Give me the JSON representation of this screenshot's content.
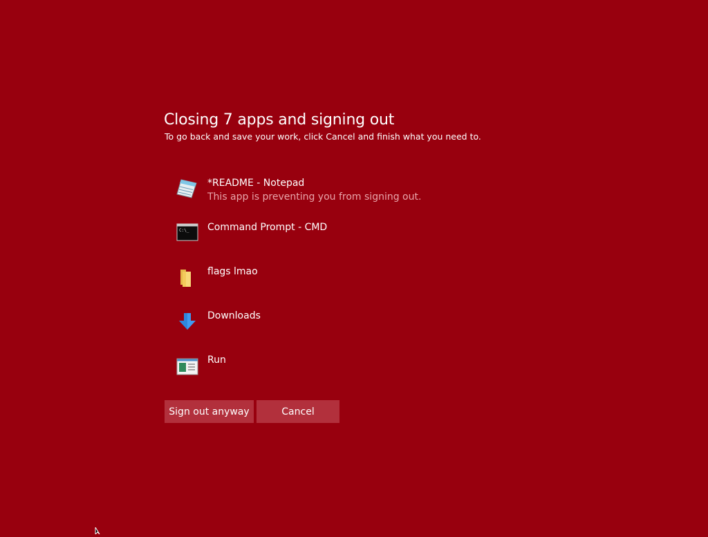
{
  "header": {
    "title": "Closing 7 apps and signing out",
    "subtitle": "To go back and save your work, click Cancel and finish what you need to."
  },
  "apps": [
    {
      "name": "*README - Notepad",
      "status": "This app is preventing you from signing out.",
      "icon": "notepad-icon"
    },
    {
      "name": "Command Prompt - CMD",
      "status": "",
      "icon": "command-prompt-icon"
    },
    {
      "name": "flags lmao",
      "status": "",
      "icon": "folder-icon"
    },
    {
      "name": "Downloads",
      "status": "",
      "icon": "downloads-icon"
    },
    {
      "name": "Run",
      "status": "",
      "icon": "run-icon"
    }
  ],
  "buttons": {
    "sign_out_label": "Sign out anyway",
    "cancel_label": "Cancel"
  },
  "colors": {
    "background": "#98000e",
    "button": "#b2303c",
    "status_text": "#e8a4aa"
  }
}
